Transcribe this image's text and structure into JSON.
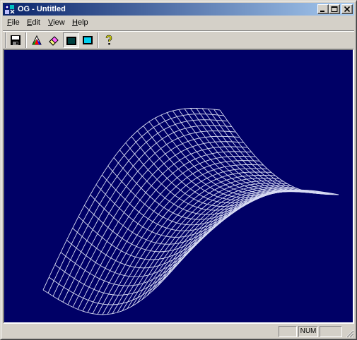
{
  "window": {
    "title": "OG - Untitled",
    "icon": "app-icon",
    "controls": [
      {
        "name": "minimize-button",
        "icon": "minimize-icon"
      },
      {
        "name": "maximize-button",
        "icon": "maximize-icon"
      },
      {
        "name": "close-button",
        "icon": "close-icon"
      }
    ]
  },
  "menubar": {
    "items": [
      {
        "accel": "F",
        "rest": "ile"
      },
      {
        "accel": "E",
        "rest": "dit"
      },
      {
        "accel": "V",
        "rest": "iew"
      },
      {
        "accel": "H",
        "rest": "elp"
      }
    ]
  },
  "toolbar": {
    "buttons": [
      {
        "name": "save-button",
        "icon": "floppy-disk-icon",
        "pressed": false
      },
      {
        "name": "color-button",
        "icon": "color-prism-icon",
        "pressed": false
      },
      {
        "name": "eraser-button",
        "icon": "eraser-icon",
        "pressed": false
      },
      {
        "name": "wireframe-mode-button",
        "icon": "dark-screen-icon",
        "pressed": true
      },
      {
        "name": "solid-mode-button",
        "icon": "cyan-screen-icon",
        "pressed": false
      },
      {
        "name": "help-button",
        "icon": "help-question-icon",
        "pressed": false
      }
    ]
  },
  "viewport": {
    "background_color": "#000066",
    "mesh_color": "#d8dcf4",
    "content": "3D wireframe surface mesh"
  },
  "statusbar": {
    "panes": [
      "",
      "NUM",
      ""
    ]
  }
}
